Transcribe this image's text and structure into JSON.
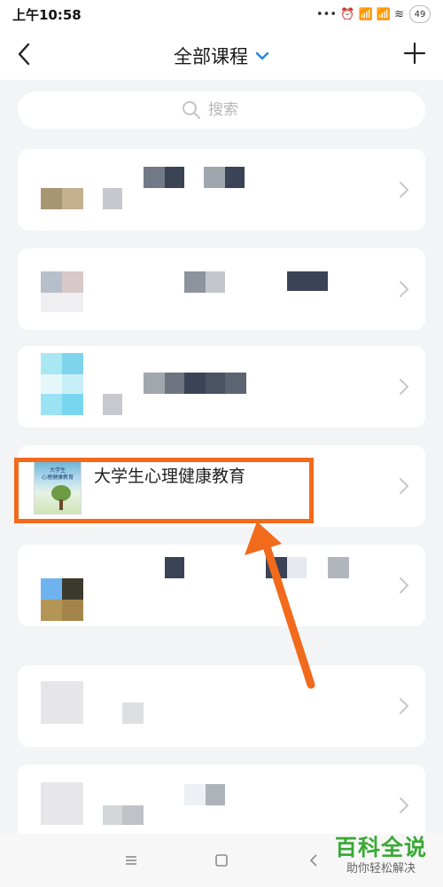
{
  "status_bar": {
    "time": "上午10:58",
    "indicators": "••• ⏰ 📶 📶 ≋",
    "battery": "49"
  },
  "header": {
    "title": "全部课程"
  },
  "search": {
    "placeholder": "搜索"
  },
  "courses": [
    {
      "title": ""
    },
    {
      "title": ""
    },
    {
      "title": ""
    },
    {
      "title": "大学生心理健康教育",
      "cover_text": "大学生\n心理健康教育"
    },
    {
      "title": ""
    },
    {
      "title": ""
    },
    {
      "title": ""
    }
  ],
  "watermark": {
    "main": "百科全说",
    "sub": "助你轻松解决"
  },
  "colors": {
    "accent_blue": "#1e88e5",
    "highlight_orange": "#f26a1b",
    "watermark_green": "#3aa935"
  }
}
